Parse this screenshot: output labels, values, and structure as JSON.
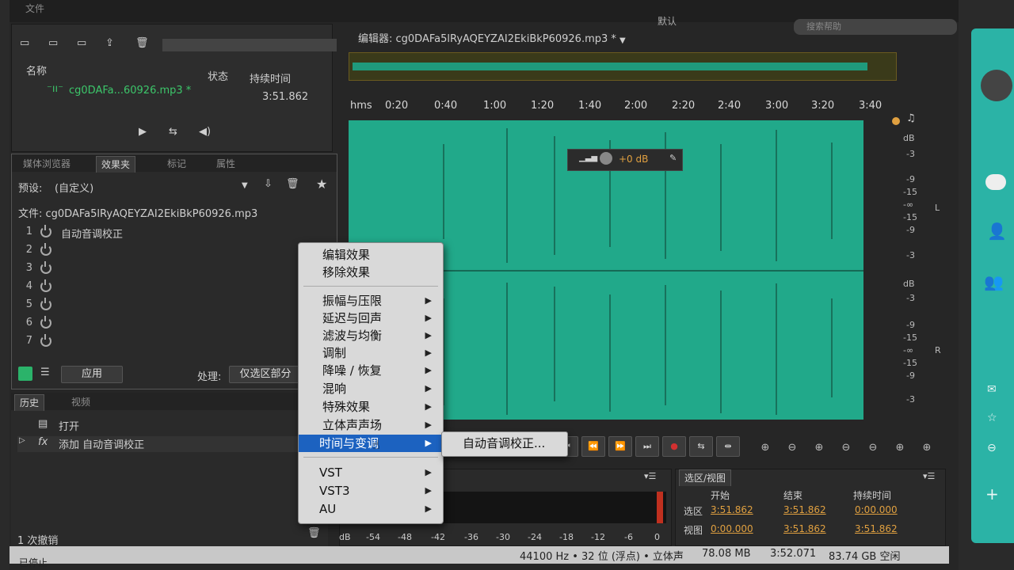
{
  "app": {
    "editor_title": "编辑器: cg0DAFa5lRyAQEYZAI2EkiBkP60926.mp3 *",
    "workspace": "默认",
    "search_placeholder": "搜索帮助"
  },
  "files_panel": {
    "col_name": "名称",
    "col_status": "状态",
    "col_duration": "持续时间",
    "file_name": "cg0DAFa...60926.mp3 *",
    "file_duration": "3:51.862"
  },
  "effects_panel": {
    "tabs": [
      "媒体浏览器",
      "效果夹",
      "标记",
      "属性"
    ],
    "preset_label": "预设:",
    "preset_value": "(自定义)",
    "file_label": "文件: cg0DAFa5lRyAQEYZAI2EkiBkP60926.mp3",
    "slots": [
      {
        "num": "1",
        "name": "自动音调校正"
      },
      {
        "num": "2",
        "name": ""
      },
      {
        "num": "3",
        "name": ""
      },
      {
        "num": "4",
        "name": ""
      },
      {
        "num": "5",
        "name": ""
      },
      {
        "num": "6",
        "name": ""
      },
      {
        "num": "7",
        "name": ""
      }
    ],
    "apply_label": "应用",
    "process_label": "处理:",
    "process_value": "仅选区部分"
  },
  "history_panel": {
    "tabs": [
      "历史",
      "视频"
    ],
    "items": [
      {
        "label": "打开"
      },
      {
        "label": "添加 自动音调校正"
      }
    ],
    "undo_count": "1 次撤销",
    "status": "已停止"
  },
  "timeline": {
    "ticks": [
      "hms",
      "0:20",
      "0:40",
      "1:00",
      "1:20",
      "1:40",
      "2:00",
      "2:20",
      "2:40",
      "3:00",
      "3:20",
      "3:40"
    ],
    "volume": "+0 dB"
  },
  "db_scale_top": [
    "dB",
    "-3",
    "-9",
    "-15",
    "-∞",
    "-15",
    "-9",
    "-3"
  ],
  "db_scale_bottom": [
    "dB",
    "-3",
    "-9",
    "-15",
    "-∞",
    "-15",
    "-9",
    "-3"
  ],
  "channel_left": "L",
  "channel_right": "R",
  "context_menu": {
    "items": [
      {
        "label": "编辑效果",
        "arrow": false
      },
      {
        "label": "移除效果",
        "arrow": false
      },
      {
        "label": "振幅与压限",
        "arrow": true
      },
      {
        "label": "延迟与回声",
        "arrow": true
      },
      {
        "label": "滤波与均衡",
        "arrow": true
      },
      {
        "label": "调制",
        "arrow": true
      },
      {
        "label": "降噪 / 恢复",
        "arrow": true
      },
      {
        "label": "混响",
        "arrow": true
      },
      {
        "label": "特殊效果",
        "arrow": true
      },
      {
        "label": "立体声声场",
        "arrow": true
      },
      {
        "label": "时间与变调",
        "arrow": true
      },
      {
        "label": "VST",
        "arrow": true
      },
      {
        "label": "VST3",
        "arrow": true
      },
      {
        "label": "AU",
        "arrow": true
      }
    ],
    "submenu_item": "自动音调校正..."
  },
  "level_meter": {
    "labels": [
      "dB",
      "-54",
      "-48",
      "-42",
      "-36",
      "-30",
      "-24",
      "-18",
      "-12",
      "-6",
      "0"
    ]
  },
  "selection_panel": {
    "title": "选区/视图",
    "col_start": "开始",
    "col_end": "结束",
    "col_duration": "持续时间",
    "rows": [
      {
        "label": "选区",
        "start": "3:51.862",
        "end": "3:51.862",
        "duration": "0:00.000"
      },
      {
        "label": "视图",
        "start": "0:00.000",
        "end": "3:51.862",
        "duration": "3:51.862"
      }
    ]
  },
  "status_bar": {
    "sample_info": "44100 Hz • 32 位 (浮点) • 立体声",
    "size": "78.08 MB",
    "duration": "3:52.071",
    "free_space": "83.74 GB 空闲"
  },
  "colors": {
    "waveform": "#21a98a",
    "menu_highlight": "#1c62c0",
    "accent": "#e0a040"
  }
}
